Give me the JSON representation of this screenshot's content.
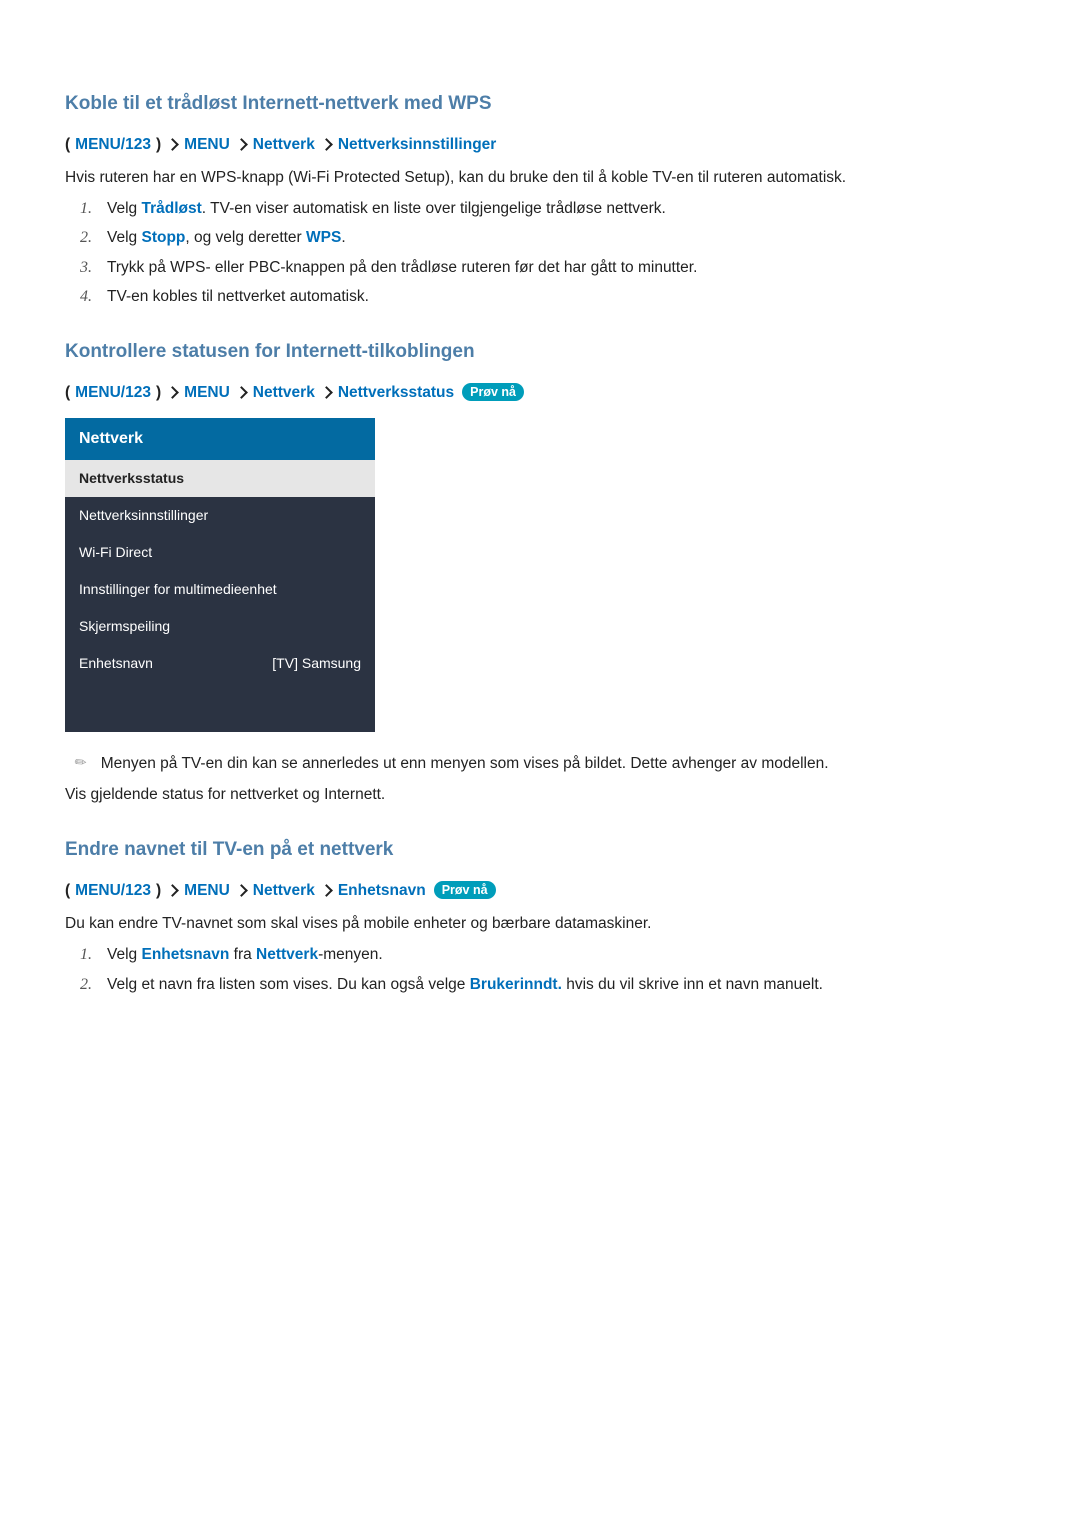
{
  "section1": {
    "heading": "Koble til et trådløst Internett-nettverk med WPS",
    "bc": {
      "a": "MENU/123",
      "b": "MENU",
      "c": "Nettverk",
      "d": "Nettverksinnstillinger"
    },
    "intro": "Hvis ruteren har en WPS-knapp (Wi-Fi Protected Setup), kan du bruke den til å koble TV-en til ruteren automatisk.",
    "li1a": "Velg ",
    "li1blue": "Trådløst",
    "li1b": ". TV-en viser automatisk en liste over tilgjengelige trådløse nettverk.",
    "li2a": "Velg ",
    "li2blue1": "Stopp",
    "li2b": ", og velg deretter ",
    "li2blue2": "WPS",
    "li2c": ".",
    "li3": "Trykk på WPS- eller PBC-knappen på den trådløse ruteren før det har gått to minutter.",
    "li4": "TV-en kobles til nettverket automatisk."
  },
  "section2": {
    "heading": "Kontrollere statusen for Internett-tilkoblingen",
    "bc": {
      "a": "MENU/123",
      "b": "MENU",
      "c": "Nettverk",
      "d": "Nettverksstatus"
    },
    "trynow": "Prøv nå",
    "panel": {
      "title": "Nettverk",
      "items": [
        "Nettverksstatus",
        "Nettverksinnstillinger",
        "Wi-Fi Direct",
        "Innstillinger for multimedieenhet",
        "Skjermspeiling"
      ],
      "lastLabel": "Enhetsnavn",
      "lastValue": "[TV] Samsung"
    },
    "note": "Menyen på TV-en din kan se annerledes ut enn menyen som vises på bildet. Dette avhenger av modellen.",
    "desc": "Vis gjeldende status for nettverket og Internett."
  },
  "section3": {
    "heading": "Endre navnet til TV-en på et nettverk",
    "bc": {
      "a": "MENU/123",
      "b": "MENU",
      "c": "Nettverk",
      "d": "Enhetsnavn"
    },
    "trynow": "Prøv nå",
    "intro": "Du kan endre TV-navnet som skal vises på mobile enheter og bærbare datamaskiner.",
    "li1a": "Velg ",
    "li1blue1": "Enhetsnavn",
    "li1b": " fra ",
    "li1blue2": "Nettverk",
    "li1c": "-menyen.",
    "li2a": "Velg et navn fra listen som vises. Du kan også velge ",
    "li2blue": "Brukerinndt.",
    "li2b": " hvis du vil skrive inn et navn manuelt."
  },
  "nums": {
    "1": "1.",
    "2": "2.",
    "3": "3.",
    "4": "4."
  }
}
